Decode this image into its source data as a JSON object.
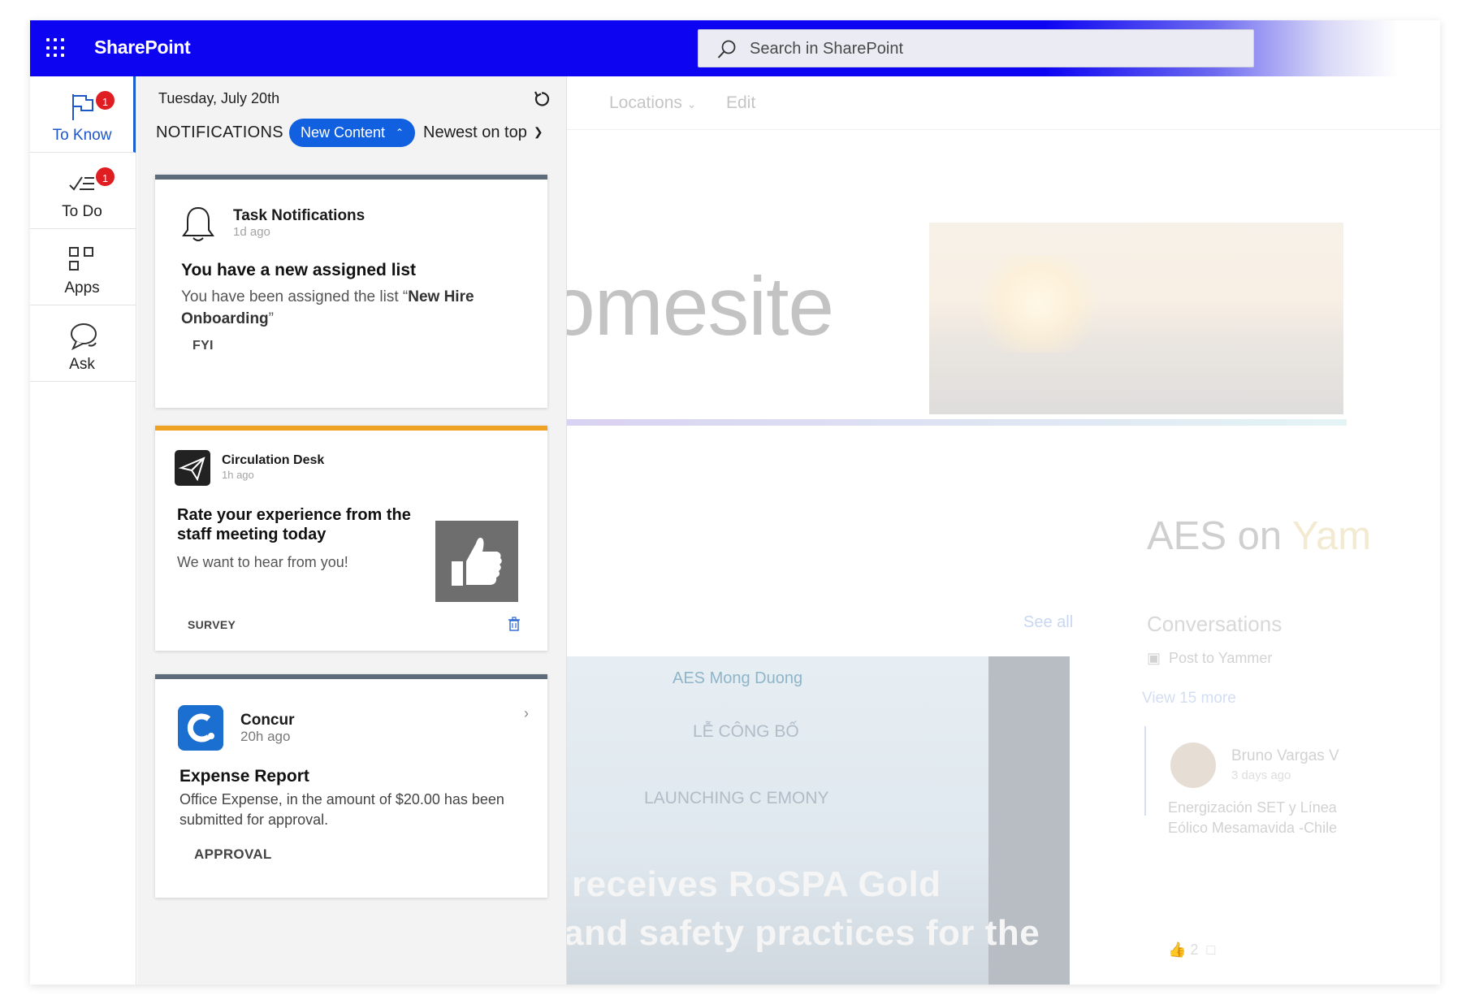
{
  "app": {
    "brand": "SharePoint",
    "accent_color": "#0d05f2",
    "search_placeholder": "Search in SharePoint"
  },
  "rail": {
    "items": [
      {
        "label": "To Know",
        "icon": "flag-icon",
        "badge": "1",
        "active": true
      },
      {
        "label": "To Do",
        "icon": "checklist-icon",
        "badge": "1",
        "active": false
      },
      {
        "label": "Apps",
        "icon": "apps-grid-icon",
        "active": false
      },
      {
        "label": "Ask",
        "icon": "chat-bubble-icon",
        "active": false
      }
    ]
  },
  "panel": {
    "date": "Tuesday, July 20th",
    "title": "NOTIFICATIONS",
    "filter_label": "New Content",
    "sort_label": "Newest on top",
    "cards": [
      {
        "source": "Task Notifications",
        "time": "1d ago",
        "icon": "bell-icon",
        "headline": "You have a new assigned list",
        "body_prefix": "You have been assigned the list “",
        "body_bold": "New Hire Onboarding",
        "body_suffix": "”",
        "tag": "FYI",
        "top_color": "#5e6b7a"
      },
      {
        "source": "Circulation Desk",
        "time": "1h ago",
        "icon": "paper-plane-icon",
        "headline": "Rate your experience from the staff meeting today",
        "body": "We want to hear from you!",
        "tag": "SURVEY",
        "image": "thumbs-up-icon",
        "top_color": "#f0a224"
      },
      {
        "source": "Concur",
        "time": "20h ago",
        "icon": "concur-logo-icon",
        "headline": "Expense Report",
        "body": "Office Expense, in the amount of $20.00 has been submitted for approval.",
        "tag": "APPROVAL",
        "top_color": "#5e6b7a"
      }
    ]
  },
  "site": {
    "nav": [
      "Locations",
      "Edit"
    ],
    "hero_title": "omesite",
    "aes_heading_a": "AES on ",
    "aes_heading_b": "Yam",
    "see_all": "See all",
    "conversations": "Conversations",
    "post_to_yammer": "Post to Yammer",
    "view_more": "View 15 more",
    "post_author": "Bruno Vargas V",
    "post_time": "3 days ago",
    "post_line1": "Energización SET y Línea",
    "post_line2": "Eólico Mesamavida -Chile",
    "likes": "2",
    "news_line1": "receives RoSPA Gold",
    "news_line2": "and safety practices for the",
    "poster_logo": "AES Mong Duong",
    "poster_title1": "LỄ CÔNG BỐ",
    "poster_title2": "LAUNCHING C  EMONY"
  }
}
